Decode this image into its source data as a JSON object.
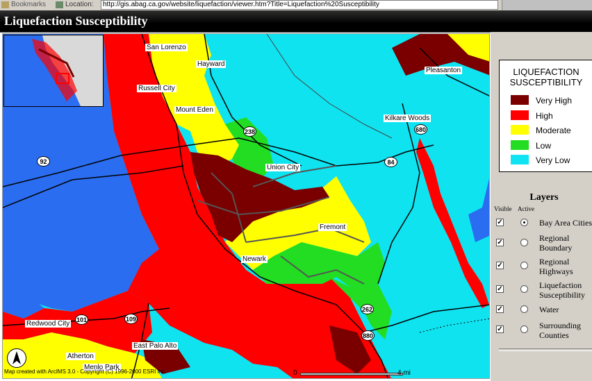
{
  "browser": {
    "bookmarks_label": "Bookmarks",
    "location_label": "Location:",
    "url": "http://gis.abag.ca.gov/website/liquefaction/viewer.htm?Title=Liquefaction%20Susceptibility"
  },
  "page_title": "Liquefaction Susceptibility",
  "map": {
    "place_labels": [
      "San Lorenzo",
      "Hayward",
      "Russell City",
      "Mount Eden",
      "Union City",
      "Fremont",
      "Newark",
      "Pleasanton",
      "Kilkare Woods",
      "Redwood City",
      "East Palo Alto",
      "Atherton",
      "Menlo Park"
    ],
    "highway_shields": [
      "238",
      "92",
      "84",
      "680",
      "262",
      "880",
      "101",
      "109"
    ],
    "credits": "Map created with ArcIMS 3.0 - Copyright (C) 1996-2000 ESRI Inc.",
    "scale": {
      "start": "0",
      "end": "4 mi"
    },
    "colors": {
      "very_high": "#7a0000",
      "high": "#ff0000",
      "moderate": "#ffff00",
      "low": "#22dd22",
      "very_low": "#10e4f2",
      "water": "#2b6df0"
    }
  },
  "legend": {
    "title_line1": "LIQUEFACTION",
    "title_line2": "SUSCEPTIBILITY",
    "items": [
      {
        "label": "Very High",
        "color": "#7a0000"
      },
      {
        "label": "High",
        "color": "#ff0000"
      },
      {
        "label": "Moderate",
        "color": "#ffff00"
      },
      {
        "label": "Low",
        "color": "#22dd22"
      },
      {
        "label": "Very Low",
        "color": "#10e4f2"
      }
    ]
  },
  "layers": {
    "title": "Layers",
    "visible_header": "Visible",
    "active_header": "Active",
    "items": [
      {
        "line1": "Bay Area Cities",
        "line2": "",
        "visible": true,
        "active": true
      },
      {
        "line1": "Regional",
        "line2": "Boundary",
        "visible": true,
        "active": false
      },
      {
        "line1": "Regional",
        "line2": "Highways",
        "visible": true,
        "active": false
      },
      {
        "line1": "Liquefaction",
        "line2": "Susceptibility",
        "visible": true,
        "active": false
      },
      {
        "line1": "Water",
        "line2": "",
        "visible": true,
        "active": false
      },
      {
        "line1": "Surrounding",
        "line2": "Counties",
        "visible": true,
        "active": false
      }
    ]
  }
}
